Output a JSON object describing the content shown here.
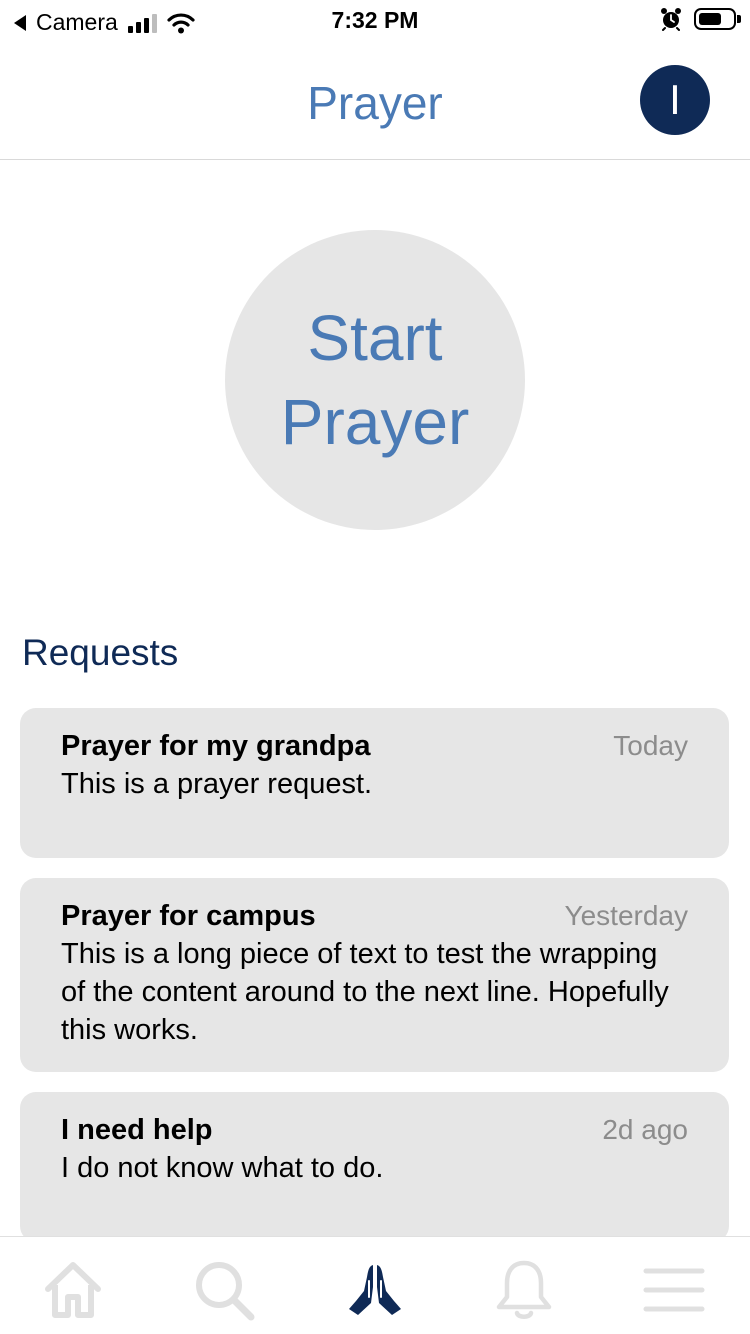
{
  "status_bar": {
    "back_label": "Camera",
    "time": "7:32 PM"
  },
  "header": {
    "title": "Prayer",
    "avatar_initial": "I"
  },
  "start_button": {
    "line1": "Start",
    "line2": "Prayer"
  },
  "requests": {
    "heading": "Requests",
    "items": [
      {
        "title": "Prayer for my grandpa",
        "time": "Today",
        "body": "This is a prayer request."
      },
      {
        "title": "Prayer for campus",
        "time": "Yesterday",
        "body": "This is a long piece of text to test the wrapping of the content around to the next line. Hopefully this works."
      },
      {
        "title": "I need help",
        "time": "2d ago",
        "body": "I do not know what to do."
      }
    ]
  },
  "tab_bar": {
    "tabs": [
      {
        "icon": "home-icon",
        "active": false
      },
      {
        "icon": "search-icon",
        "active": false
      },
      {
        "icon": "praying-hands-icon",
        "active": true
      },
      {
        "icon": "bell-icon",
        "active": false
      },
      {
        "icon": "menu-icon",
        "active": false
      }
    ]
  },
  "colors": {
    "accent": "#4a7ab5",
    "navy": "#0f2a56",
    "card_bg": "#e6e6e6",
    "inactive_icon": "#e0e0e0"
  }
}
